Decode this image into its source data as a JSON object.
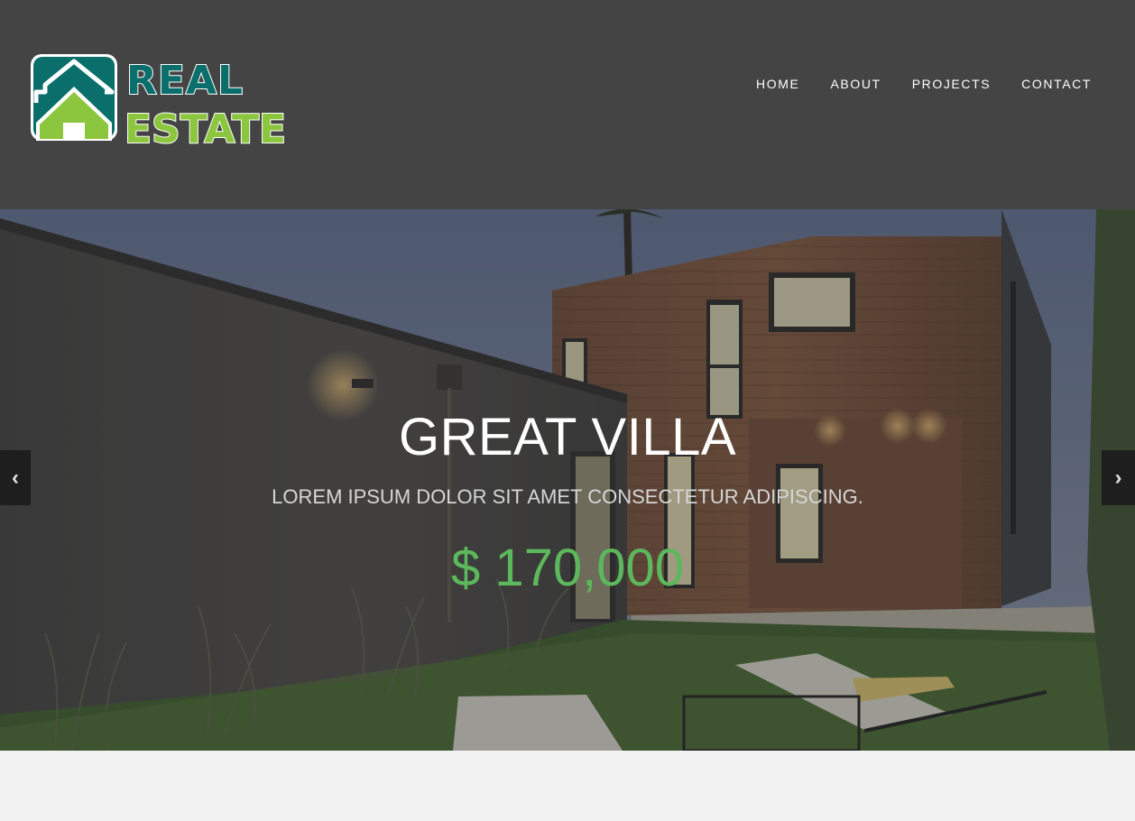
{
  "brand": {
    "logo_line1": "REAL",
    "logo_line2": "ESTATE"
  },
  "nav": {
    "items": [
      {
        "label": "HOME"
      },
      {
        "label": "ABOUT"
      },
      {
        "label": "PROJECTS"
      },
      {
        "label": "CONTACT"
      }
    ]
  },
  "hero": {
    "title": "GREAT VILLA",
    "subtitle": "LOREM IPSUM DOLOR SIT AMET CONSECTETUR ADIPISCING.",
    "price": "$ 170,000",
    "prev_icon": "‹",
    "next_icon": "›"
  },
  "colors": {
    "header_bg": "#444444",
    "accent_green": "#5cb85c",
    "logo_teal": "#0a6e6a",
    "logo_green": "#8cc63f"
  }
}
